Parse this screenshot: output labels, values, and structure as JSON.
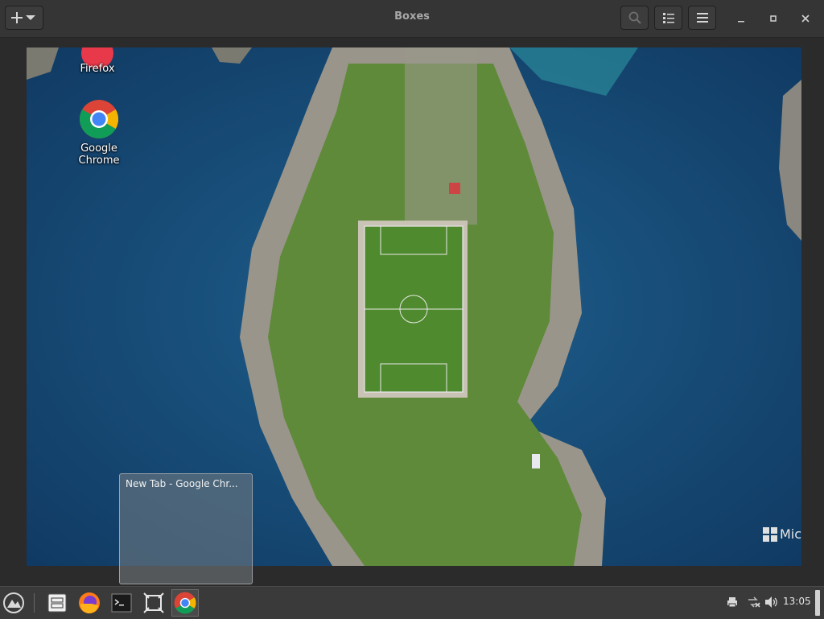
{
  "window": {
    "title": "Boxes",
    "add_button_icon": "plus-icon",
    "search_icon": "search-icon",
    "view_list_icon": "list-view-icon",
    "menu_icon": "hamburger-menu-icon",
    "minimize_icon": "minimize-icon",
    "maximize_icon": "maximize-icon",
    "close_icon": "close-icon"
  },
  "desktop": {
    "icons": [
      {
        "label": "Firefox",
        "icon": "firefox-icon"
      },
      {
        "label": "Google Chrome",
        "icon": "chrome-icon"
      }
    ],
    "watermark": "Mic"
  },
  "preview": {
    "title": "New Tab - Google Chr..."
  },
  "taskbar": {
    "apps": [
      {
        "name": "start-menu",
        "icon": "zorin-logo-icon"
      },
      {
        "name": "files",
        "icon": "files-icon"
      },
      {
        "name": "firefox",
        "icon": "firefox-icon"
      },
      {
        "name": "terminal",
        "icon": "terminal-icon"
      },
      {
        "name": "boxes",
        "icon": "boxes-icon"
      },
      {
        "name": "chrome",
        "icon": "chrome-icon"
      }
    ],
    "tray": [
      "printer-icon",
      "network-icon",
      "volume-icon"
    ],
    "clock": "13:05"
  },
  "colors": {
    "titlebar": "#353535",
    "taskbar": "#3a3a3a",
    "sea": "#1a4d7a",
    "pitch": "#4f8a2e"
  }
}
